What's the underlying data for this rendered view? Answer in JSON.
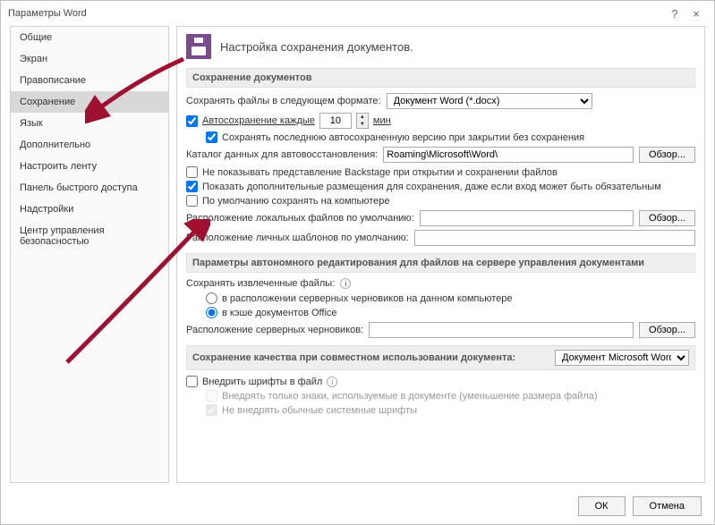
{
  "titlebar": {
    "title": "Параметры Word",
    "help": "?",
    "close": "×"
  },
  "sidebar": {
    "items": [
      "Общие",
      "Экран",
      "Правописание",
      "Сохранение",
      "Язык",
      "Дополнительно",
      "Настроить ленту",
      "Панель быстрого доступа",
      "Надстройки",
      "Центр управления безопасностью"
    ],
    "selected_index": 3
  },
  "header": {
    "title": "Настройка сохранения документов."
  },
  "sections": {
    "save_docs": {
      "title": "Сохранение документов",
      "format_label": "Сохранять файлы в следующем формате:",
      "format_value": "Документ Word (*.docx)",
      "autosave_label": "Автосохранение каждые",
      "autosave_value": "10",
      "autosave_unit": "мин",
      "keep_last_label": "Сохранять последнюю автосохраненную версию при закрытии без сохранения",
      "autorecover_label": "Каталог данных для автовосстановления:",
      "autorecover_value": "Roaming\\Microsoft\\Word\\",
      "browse": "Обзор...",
      "no_backstage_label": "Не показывать представление Backstage при открытии и сохранении файлов",
      "show_additional_label": "Показать дополнительные размещения для сохранения, даже если вход может быть обязательным",
      "default_computer_label": "По умолчанию сохранять на компьютере",
      "local_files_label": "Расположение локальных файлов по умолчанию:",
      "local_files_value": "",
      "templates_label": "Расположение личных шаблонов по умолчанию:",
      "templates_value": ""
    },
    "offline": {
      "title": "Параметры автономного редактирования для файлов на сервере управления документами",
      "checked_out_label": "Сохранять извлеченные файлы:",
      "radio_server": "в расположении серверных черновиков на данном компьютере",
      "radio_cache": "в кэше документов Office",
      "drafts_label": "Расположение серверных черновиков:",
      "drafts_value": "",
      "browse": "Обзор..."
    },
    "fidelity": {
      "title": "Сохранение качества при совместном использовании документа:",
      "doc_value": "Документ Microsoft Word",
      "embed_label": "Внедрить шрифты в файл",
      "embed_used_label": "Внедрять только знаки, используемые в документе (уменьшение размера файла)",
      "no_system_label": "Не внедрять обычные системные шрифты"
    }
  },
  "footer": {
    "ok": "ОК",
    "cancel": "Отмена"
  }
}
